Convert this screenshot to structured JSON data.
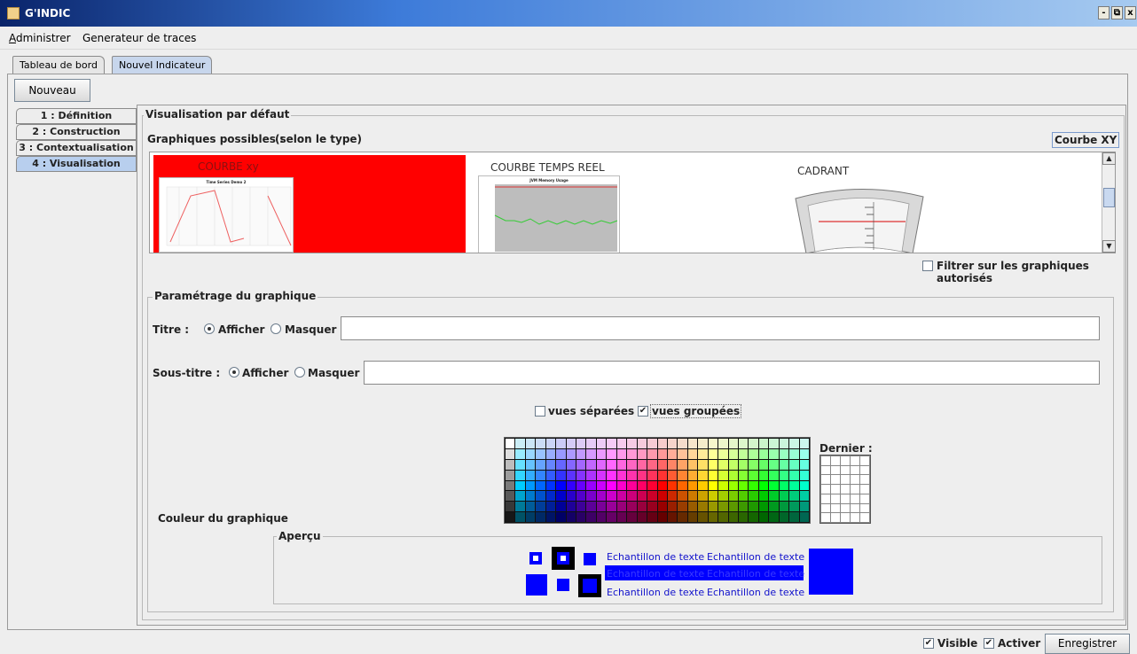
{
  "window": {
    "title": "G'INDIC",
    "buttons": [
      "-",
      "⧉",
      "x"
    ]
  },
  "menu": {
    "items": [
      {
        "first": "A",
        "rest": "dministrer"
      },
      {
        "first": "",
        "rest": "Generateur de traces"
      }
    ]
  },
  "tabs": [
    {
      "label": "Tableau de bord"
    },
    {
      "label": "Nouvel Indicateur"
    }
  ],
  "toolbar": {
    "new_label": "Nouveau"
  },
  "steps": [
    {
      "label": "1 : Définition"
    },
    {
      "label": "2 : Construction"
    },
    {
      "label": "3 : Contextualisation"
    },
    {
      "label": "4 : Visualisation"
    }
  ],
  "visualisation": {
    "group_label": "Visualisation par défaut",
    "possible_label": "Graphiques possibles :",
    "possible_hint": "(selon le type)",
    "selected_type": "Courbe XY",
    "thumbnails": [
      {
        "title": "COURBE xy",
        "chart_title": "Time Series Demo 2"
      },
      {
        "title": "COURBE TEMPS REEL",
        "chart_title": "JVM Memory Usage"
      },
      {
        "title": "CADRANT"
      }
    ],
    "filter_label": "Filtrer sur les graphiques autorisés"
  },
  "settings": {
    "group_label": "Paramétrage du graphique",
    "titre_label": "Titre :",
    "sous_titre_label": "Sous-titre :",
    "afficher": "Afficher",
    "masquer": "Masquer",
    "titre_value": "",
    "sous_titre_value": "",
    "vues_separees": "vues séparées",
    "vues_groupees": "vues groupées",
    "couleur_label": "Couleur du graphique",
    "dernier_label": "Dernier :",
    "apercu_label": "Aperçu",
    "sample_text": "Echantillon de texte",
    "selected_color": "#0000ff"
  },
  "footer": {
    "visible_label": "Visible",
    "activer_label": "Activer",
    "save_label": "Enregistrer"
  },
  "colors": {
    "accent": "#0000ff",
    "title_gradient_start": "#0a246a",
    "selected_thumbnail": "#ff0000"
  }
}
